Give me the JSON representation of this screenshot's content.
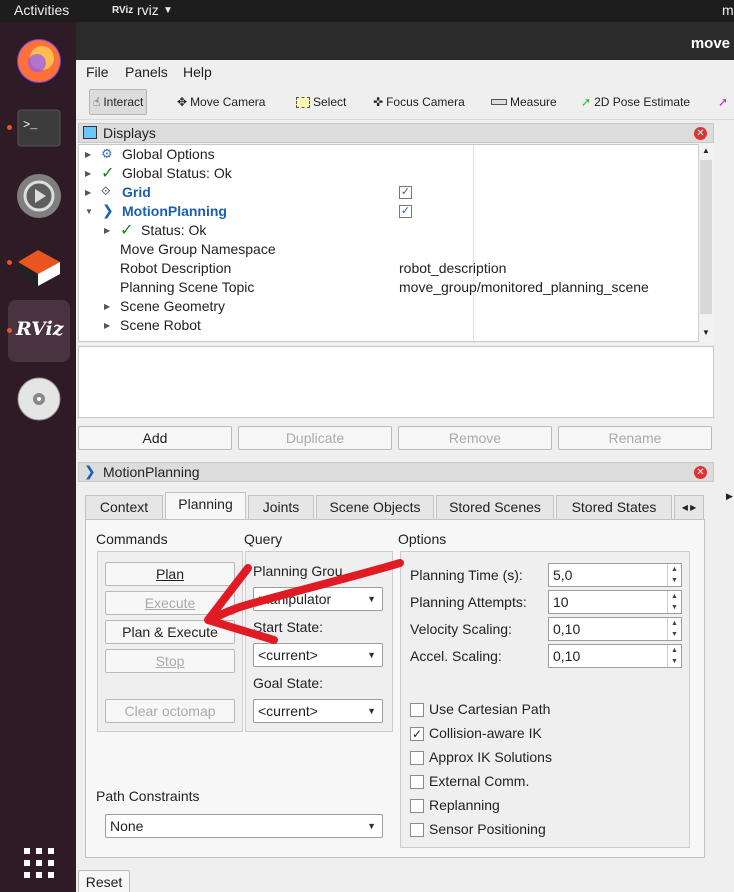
{
  "topbar": {
    "activities": "Activities",
    "app_name": "rviz",
    "app_logo_text": "RViz",
    "clock": "m"
  },
  "window": {
    "title": "move"
  },
  "dock": {
    "rviz_label": "RViz"
  },
  "menubar": {
    "file": "File",
    "panels": "Panels",
    "help": "Help"
  },
  "toolbar": {
    "interact": "Interact",
    "move_camera": "Move Camera",
    "select": "Select",
    "focus_camera": "Focus Camera",
    "measure": "Measure",
    "pose_estimate": "2D Pose Estimate"
  },
  "displays": {
    "title": "Displays",
    "rows": [
      {
        "label": "Global Options",
        "value": ""
      },
      {
        "label": "Global Status: Ok",
        "value": ""
      },
      {
        "label": "Grid",
        "value": ""
      },
      {
        "label": "MotionPlanning",
        "value": ""
      },
      {
        "label": "Status: Ok",
        "value": ""
      },
      {
        "label": "Move Group Namespace",
        "value": ""
      },
      {
        "label": "Robot Description",
        "value": "robot_description"
      },
      {
        "label": "Planning Scene Topic",
        "value": "move_group/monitored_planning_scene"
      },
      {
        "label": "Scene Geometry",
        "value": ""
      },
      {
        "label": "Scene Robot",
        "value": ""
      }
    ],
    "grid_checked": true,
    "motion_checked": true,
    "buttons": {
      "add": "Add",
      "duplicate": "Duplicate",
      "remove": "Remove",
      "rename": "Rename"
    }
  },
  "motion_panel": {
    "title": "MotionPlanning",
    "tabs": [
      "Context",
      "Planning",
      "Joints",
      "Scene Objects",
      "Stored Scenes",
      "Stored States"
    ],
    "selected_tab": "Planning",
    "commands": {
      "title": "Commands",
      "plan": "Plan",
      "execute": "Execute",
      "plan_execute": "Plan & Execute",
      "stop": "Stop",
      "clear_octomap": "Clear octomap"
    },
    "query": {
      "title": "Query",
      "planning_group_label": "Planning Grou",
      "planning_group_value": "manipulator",
      "start_state_label": "Start State:",
      "start_state_value": "<current>",
      "goal_state_label": "Goal State:",
      "goal_state_value": "<current>"
    },
    "options": {
      "title": "Options",
      "planning_time_label": "Planning Time (s):",
      "planning_time_value": "5,0",
      "planning_attempts_label": "Planning Attempts:",
      "planning_attempts_value": "10",
      "velocity_label": "Velocity Scaling:",
      "velocity_value": "0,10",
      "accel_label": "Accel. Scaling:",
      "accel_value": "0,10",
      "checks": [
        {
          "label": "Use Cartesian Path",
          "checked": false
        },
        {
          "label": "Collision-aware IK",
          "checked": true
        },
        {
          "label": "Approx IK Solutions",
          "checked": false
        },
        {
          "label": "External Comm.",
          "checked": false
        },
        {
          "label": "Replanning",
          "checked": false
        },
        {
          "label": "Sensor Positioning",
          "checked": false
        }
      ]
    },
    "path_constraints": {
      "label": "Path Constraints",
      "value": "None"
    },
    "reset": "Reset"
  },
  "colors": {
    "accent_blue": "#1a5fb4",
    "annotation_red": "#e01b24",
    "dock_bg": "#2f1b26"
  }
}
